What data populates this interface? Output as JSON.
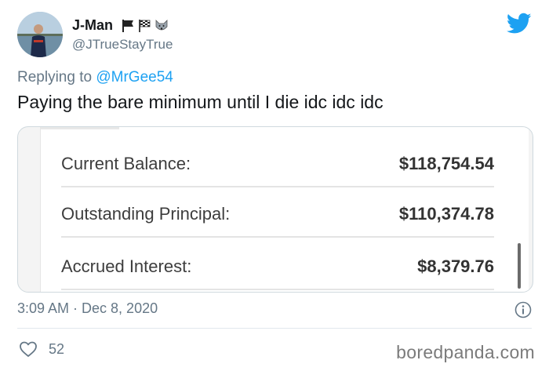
{
  "author": {
    "display_name": "J-Man",
    "handle": "@JTrueStayTrue",
    "name_emoji_icons": [
      "black-flag-icon",
      "checkered-flag-icon",
      "wolf-face-icon"
    ]
  },
  "reply": {
    "prefix": "Replying to",
    "mention": "@MrGee54"
  },
  "tweet_text": "Paying the bare minimum until I die idc idc idc",
  "media": {
    "rows": [
      {
        "label": "Current Balance:",
        "value": "$118,754.54"
      },
      {
        "label": "Outstanding Principal:",
        "value": "$110,374.78"
      },
      {
        "label": "Accrued Interest:",
        "value": "$8,379.76"
      }
    ]
  },
  "footer": {
    "timestamp": "3:09 AM · Dec 8, 2020",
    "like_count": "52",
    "watermark": "boredpanda.com"
  },
  "colors": {
    "twitter_blue": "#1da1f2",
    "secondary_text": "#657786"
  }
}
